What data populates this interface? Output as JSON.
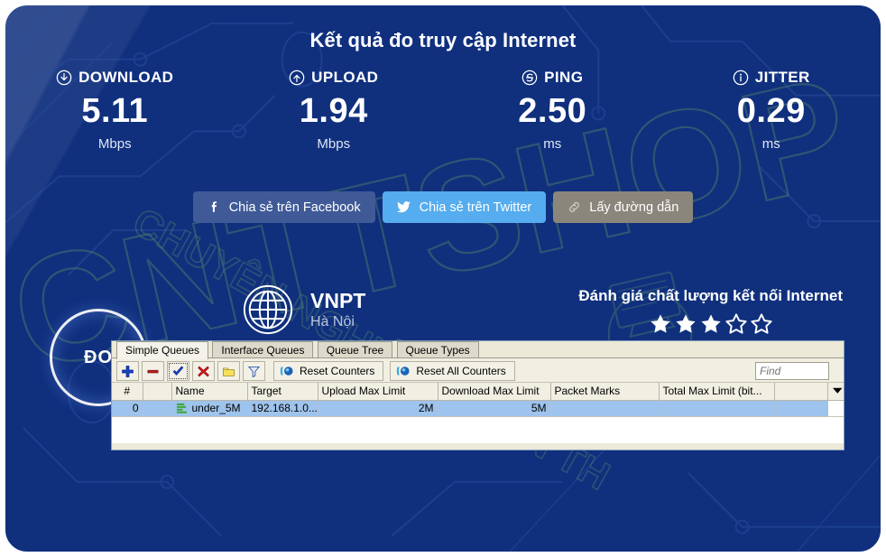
{
  "speedtest": {
    "title": "Kết quả đo truy cập Internet",
    "metrics": [
      {
        "icon": "download-arrow-icon",
        "label": "DOWNLOAD",
        "value": "5.11",
        "unit": "Mbps"
      },
      {
        "icon": "upload-arrow-icon",
        "label": "UPLOAD",
        "value": "1.94",
        "unit": "Mbps"
      },
      {
        "icon": "ping-icon",
        "label": "PING",
        "value": "2.50",
        "unit": "ms"
      },
      {
        "icon": "info-icon",
        "label": "JITTER",
        "value": "0.29",
        "unit": "ms"
      }
    ],
    "share": {
      "facebook": {
        "label": "Chia sẻ trên Facebook",
        "icon": "facebook-icon",
        "color": "#3f5a97"
      },
      "twitter": {
        "label": "Chia sẻ trên Twitter",
        "icon": "twitter-icon",
        "color": "#55acee"
      },
      "copy": {
        "label": "Lấy đường dẫn",
        "icon": "link-icon",
        "color": "#8b867c"
      }
    },
    "isp": {
      "icon": "globe-icon",
      "name": "VNPT",
      "location": "Hà Nội"
    },
    "rating": {
      "label": "Đánh giá chất lượng kết nối Internet",
      "filled": 3,
      "total": 5
    },
    "measure_button": "ĐO",
    "watermark": {
      "main": "CNTTSHOP",
      "sub": "CHUYÊN NGHIỆP - THẬN TH"
    }
  },
  "winbox": {
    "tabs": [
      {
        "label": "Simple Queues",
        "active": true
      },
      {
        "label": "Interface Queues",
        "active": false
      },
      {
        "label": "Queue Tree",
        "active": false
      },
      {
        "label": "Queue Types",
        "active": false
      }
    ],
    "toolbar": {
      "icon_buttons": [
        {
          "name": "add-button",
          "icon": "plus-icon",
          "pressed": false
        },
        {
          "name": "remove-button",
          "icon": "minus-icon",
          "pressed": false
        },
        {
          "name": "enable-button",
          "icon": "check-icon",
          "pressed": true
        },
        {
          "name": "disable-button",
          "icon": "red-x-icon",
          "pressed": false
        },
        {
          "name": "comment-button",
          "icon": "note-icon",
          "pressed": false
        },
        {
          "name": "filter-button",
          "icon": "funnel-icon",
          "pressed": false
        }
      ],
      "reset_counters": "Reset Counters",
      "reset_all_counters": "Reset All Counters",
      "find_placeholder": "Find",
      "find_value": ""
    },
    "table": {
      "columns": [
        "#",
        "",
        "Name",
        "Target",
        "Upload Max Limit",
        "Download Max Limit",
        "Packet Marks",
        "Total Max Limit (bit...",
        ""
      ],
      "rows": [
        {
          "num": "0",
          "flag": "",
          "icon": "queue-icon",
          "name": "under_5M",
          "target": "192.168.1.0...",
          "upload_max_limit": "2M",
          "download_max_limit": "5M",
          "packet_marks": "",
          "total_max_limit": "",
          "extra": ""
        }
      ]
    }
  }
}
